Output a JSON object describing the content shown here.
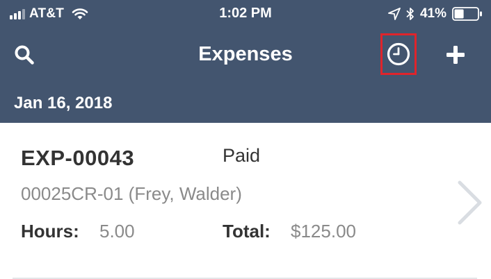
{
  "status_bar": {
    "carrier": "AT&T",
    "time": "1:02 PM",
    "battery_percent": "41%",
    "battery_level": 0.41,
    "signal_bars_filled": 3,
    "signal_bars_total": 4
  },
  "nav": {
    "title": "Expenses",
    "search_icon": "search-icon",
    "history_icon": "clock-icon",
    "add_icon": "plus-icon"
  },
  "section": {
    "date": "Jan 16, 2018"
  },
  "expense": {
    "id": "EXP-00043",
    "status": "Paid",
    "project": "00025CR-01 (Frey, Walder)",
    "hours_label": "Hours:",
    "hours_value": "5.00",
    "total_label": "Total:",
    "total_value": "$125.00"
  },
  "colors": {
    "header_bg": "#43556f",
    "highlight_box": "#e0242b",
    "primary_text": "#333333",
    "secondary_text": "#8a8a8a"
  }
}
